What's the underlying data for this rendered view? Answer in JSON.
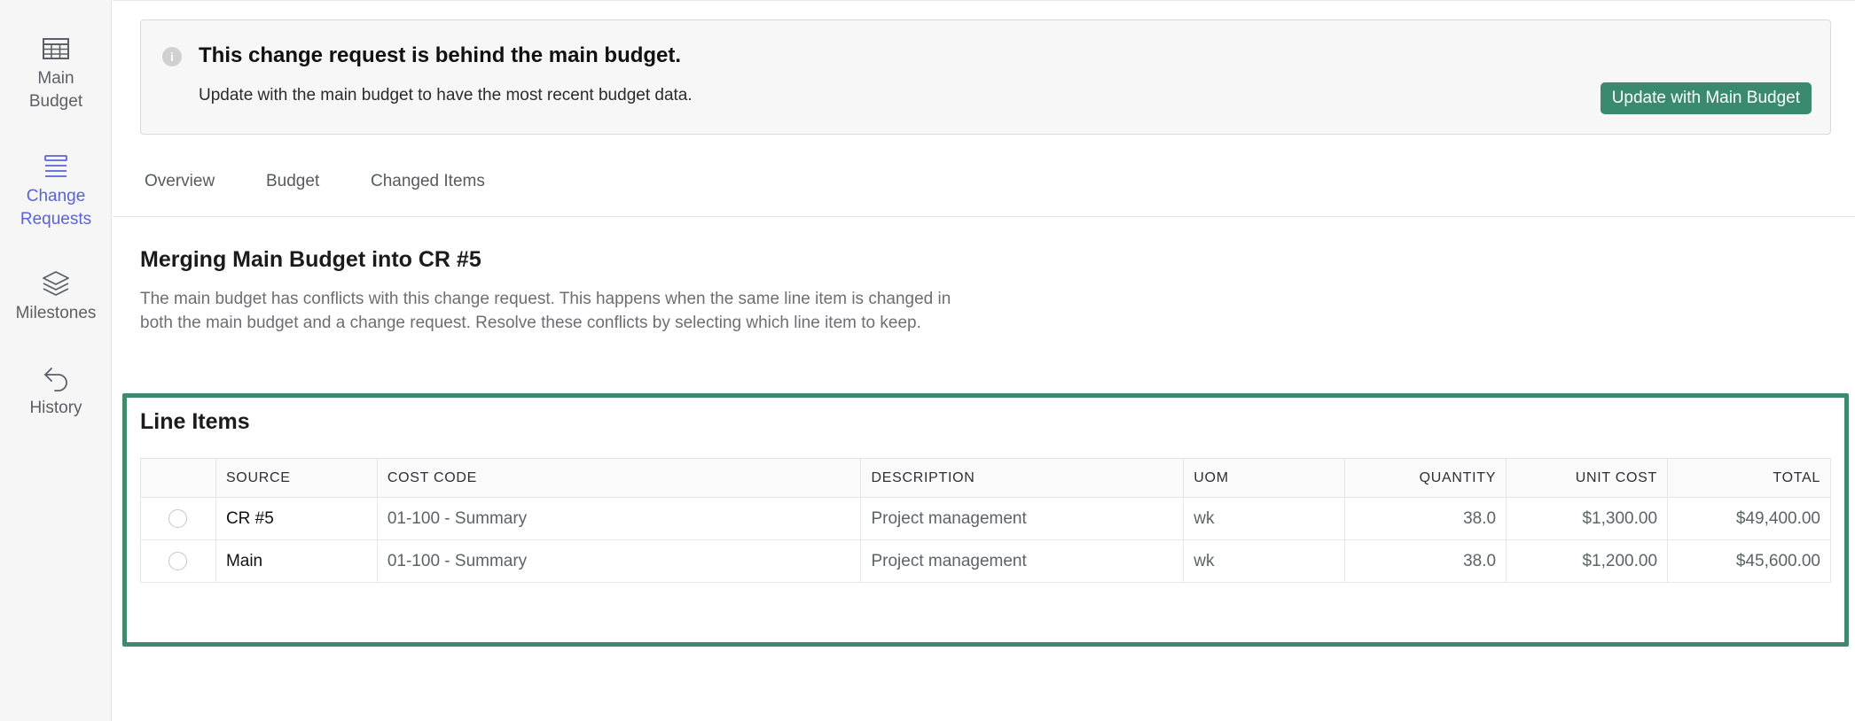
{
  "sidebar": {
    "items": [
      {
        "label_line1": "Main",
        "label_line2": "Budget",
        "icon": "table-icon",
        "active": false
      },
      {
        "label_line1": "Change",
        "label_line2": "Requests",
        "icon": "list-icon",
        "active": true
      },
      {
        "label_line1": "Milestones",
        "icon": "layers-icon",
        "active": false
      },
      {
        "label_line1": "History",
        "icon": "undo-arrow-icon",
        "active": false
      }
    ]
  },
  "alert": {
    "icon": "info-icon",
    "icon_glyph": "i",
    "title": "This change request is behind the main budget.",
    "text": "Update with the main budget to have the most recent budget data.",
    "button_label": "Update with Main Budget",
    "button_color": "#398a6e"
  },
  "tabs": [
    "Overview",
    "Budget",
    "Changed Items"
  ],
  "merge": {
    "title": "Merging Main Budget into CR #5",
    "description": "The main budget has conflicts with this change request. This happens when the same line item is changed in both the main budget and a change request. Resolve these conflicts by selecting which line item to keep."
  },
  "line_items": {
    "title": "Line Items",
    "highlight_color": "#3f8a6f",
    "columns": [
      "SOURCE",
      "COST CODE",
      "DESCRIPTION",
      "UOM",
      "QUANTITY",
      "UNIT COST",
      "TOTAL"
    ],
    "rows": [
      {
        "source": "CR #5",
        "cost_code": "01-100 - Summary",
        "description": "Project management",
        "uom": "wk",
        "quantity": "38.0",
        "unit_cost": "$1,300.00",
        "total": "$49,400.00"
      },
      {
        "source": "Main",
        "cost_code": "01-100 - Summary",
        "description": "Project management",
        "uom": "wk",
        "quantity": "38.0",
        "unit_cost": "$1,200.00",
        "total": "$45,600.00"
      }
    ]
  }
}
